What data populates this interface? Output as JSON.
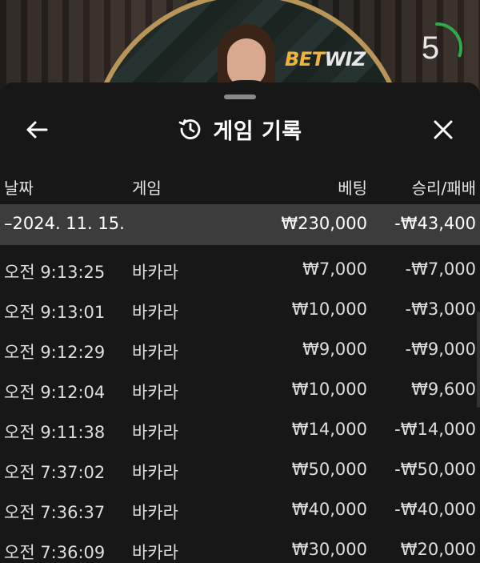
{
  "video": {
    "brand_part1": "BET",
    "brand_part2": "WIZ",
    "timer_value": "5",
    "timer_fraction": 0.3,
    "timer_color": "#2faa4a"
  },
  "sheet": {
    "title": "게임 기록",
    "back_icon": "arrow-left-icon",
    "history_icon": "history-clock-icon",
    "close_icon": "close-icon"
  },
  "table": {
    "columns": {
      "date": "날짜",
      "game": "게임",
      "bet": "베팅",
      "result": "승리/패배"
    },
    "group": {
      "date": "–2024. 11. 15.",
      "bet": "₩230,000",
      "result": "-₩43,400"
    },
    "rows": [
      {
        "time": "오전 9:13:25",
        "game": "바카라",
        "bet": "₩7,000",
        "result": "-₩7,000"
      },
      {
        "time": "오전 9:13:01",
        "game": "바카라",
        "bet": "₩10,000",
        "result": "-₩3,000"
      },
      {
        "time": "오전 9:12:29",
        "game": "바카라",
        "bet": "₩9,000",
        "result": "-₩9,000"
      },
      {
        "time": "오전 9:12:04",
        "game": "바카라",
        "bet": "₩10,000",
        "result": "₩9,600"
      },
      {
        "time": "오전 9:11:38",
        "game": "바카라",
        "bet": "₩14,000",
        "result": "-₩14,000"
      },
      {
        "time": "오전 7:37:02",
        "game": "바카라",
        "bet": "₩50,000",
        "result": "-₩50,000"
      },
      {
        "time": "오전 7:36:37",
        "game": "바카라",
        "bet": "₩40,000",
        "result": "-₩40,000"
      },
      {
        "time": "오전 7:36:09",
        "game": "바카라",
        "bet": "₩30,000",
        "result": "₩20,000"
      }
    ]
  }
}
